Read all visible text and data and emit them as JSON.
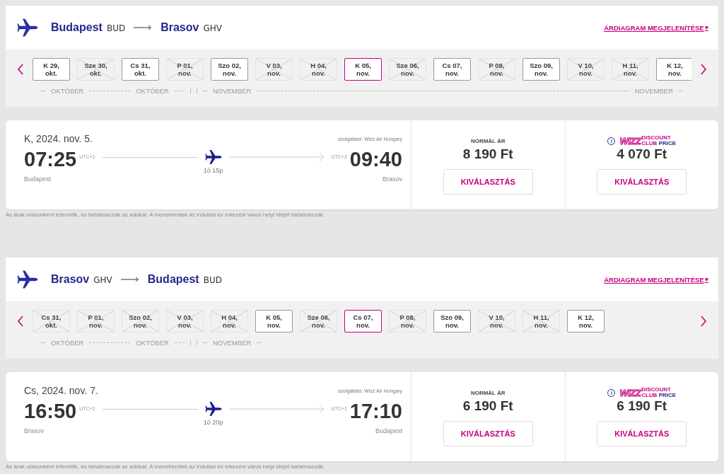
{
  "sections": [
    {
      "route": {
        "from_city": "Budapest",
        "from_code": "BUD",
        "to_city": "Brasov",
        "to_code": "GHV"
      },
      "chart_link": "ÁRDIAGRAM MEGJELENÍTÉSE",
      "chart_link_icon": "♥",
      "dates": [
        {
          "label": "K 29,\nokt.",
          "available": true,
          "selected": false
        },
        {
          "label": "Sze 30,\nokt.",
          "available": false,
          "selected": false
        },
        {
          "label": "Cs 31,\nokt.",
          "available": true,
          "selected": false
        },
        {
          "label": "P 01,\nnov.",
          "available": false,
          "selected": false
        },
        {
          "label": "Szo 02,\nnov.",
          "available": true,
          "selected": false
        },
        {
          "label": "V 03,\nnov.",
          "available": false,
          "selected": false
        },
        {
          "label": "H 04,\nnov.",
          "available": false,
          "selected": false
        },
        {
          "label": "K 05,\nnov.",
          "available": true,
          "selected": true
        },
        {
          "label": "Sze 06,\nnov.",
          "available": false,
          "selected": false
        },
        {
          "label": "Cs 07,\nnov.",
          "available": true,
          "selected": false
        },
        {
          "label": "P 08,\nnov.",
          "available": false,
          "selected": false
        },
        {
          "label": "Szo 09,\nnov.",
          "available": true,
          "selected": false
        },
        {
          "label": "V 10,\nnov.",
          "available": false,
          "selected": false
        },
        {
          "label": "H 11,\nnov.",
          "available": false,
          "selected": false
        },
        {
          "label": "K 12,\nnov.",
          "available": true,
          "selected": false
        }
      ],
      "months": [
        {
          "label": "OKTÓBER",
          "end_mark": false,
          "start_mark": false
        },
        {
          "label": "OKTÓBER",
          "end_mark": true,
          "start_mark": false
        },
        {
          "label": "NOVEMBER",
          "end_mark": false,
          "start_mark": true
        },
        {
          "label": "NOVEMBER",
          "end_mark": false,
          "start_mark": false
        }
      ],
      "flight": {
        "date": "K, 2024. nov. 5.",
        "operator": "szolgáltató: Wizz Air Hungary",
        "dep_time": "07:25",
        "dep_tz": "UTC+1",
        "arr_time": "09:40",
        "arr_tz": "UTC+2",
        "duration": "1ó 15p",
        "dep_city": "Budapest",
        "arr_city": "Brasov"
      },
      "fares": [
        {
          "kind": "normal",
          "label": "NORMÁL ÁR",
          "price": "8 190 Ft",
          "button": "KIVÁLASZTÁS"
        },
        {
          "kind": "club",
          "info_icon": "i",
          "brand": "WIZZ",
          "brand_line1": "DISCOUNT",
          "brand_line2a": "CLUB",
          "brand_line2b": "PRICE",
          "price": "4 070 Ft",
          "button": "KIVÁLASZTÁS"
        }
      ],
      "note": "Az árak utasonként értendők, és tartalmazzák az adókat. A menetrendek az indulási és érkezési város helyi idejét tartalmazzák."
    },
    {
      "route": {
        "from_city": "Brasov",
        "from_code": "GHV",
        "to_city": "Budapest",
        "to_code": "BUD"
      },
      "chart_link": "ÁRDIAGRAM MEGJELENÍTÉSE",
      "chart_link_icon": "♥",
      "dates": [
        {
          "label": "Cs 31,\nokt.",
          "available": false,
          "selected": false
        },
        {
          "label": "P 01,\nnov.",
          "available": false,
          "selected": false
        },
        {
          "label": "Szo 02,\nnov.",
          "available": false,
          "selected": false
        },
        {
          "label": "V 03,\nnov.",
          "available": false,
          "selected": false
        },
        {
          "label": "H 04,\nnov.",
          "available": false,
          "selected": false
        },
        {
          "label": "K 05,\nnov.",
          "available": true,
          "selected": false
        },
        {
          "label": "Sze 06,\nnov.",
          "available": false,
          "selected": false
        },
        {
          "label": "Cs 07,\nnov.",
          "available": true,
          "selected": true
        },
        {
          "label": "P 08,\nnov.",
          "available": false,
          "selected": false
        },
        {
          "label": "Szo 09,\nnov.",
          "available": true,
          "selected": false
        },
        {
          "label": "V 10,\nnov.",
          "available": false,
          "selected": false
        },
        {
          "label": "H 11,\nnov.",
          "available": false,
          "selected": false
        },
        {
          "label": "K 12,\nnov.",
          "available": true,
          "selected": false
        }
      ],
      "months": [
        {
          "label": "OKTÓBER",
          "end_mark": false,
          "start_mark": false
        },
        {
          "label": "OKTÓBER",
          "end_mark": true,
          "start_mark": false
        },
        {
          "label": "NOVEMBER",
          "end_mark": false,
          "start_mark": true
        }
      ],
      "flight": {
        "date": "Cs, 2024. nov. 7.",
        "operator": "szolgáltató: Wizz Air Hungary",
        "dep_time": "16:50",
        "dep_tz": "UTC+2",
        "arr_time": "17:10",
        "arr_tz": "UTC+1",
        "duration": "1ó 20p",
        "dep_city": "Brasov",
        "arr_city": "Budapest"
      },
      "fares": [
        {
          "kind": "normal",
          "label": "NORMÁL ÁR",
          "price": "6 190 Ft",
          "button": "KIVÁLASZTÁS"
        },
        {
          "kind": "club",
          "info_icon": "i",
          "brand": "WIZZ",
          "brand_line1": "DISCOUNT",
          "brand_line2a": "CLUB",
          "brand_line2b": "PRICE",
          "price": "6 190 Ft",
          "button": "KIVÁLASZTÁS"
        }
      ],
      "note": "Az árak utasonként értendők, és tartalmazzák az adókat. A menetrendek az indulási és érkezési város helyi idejét tartalmazzák."
    }
  ]
}
